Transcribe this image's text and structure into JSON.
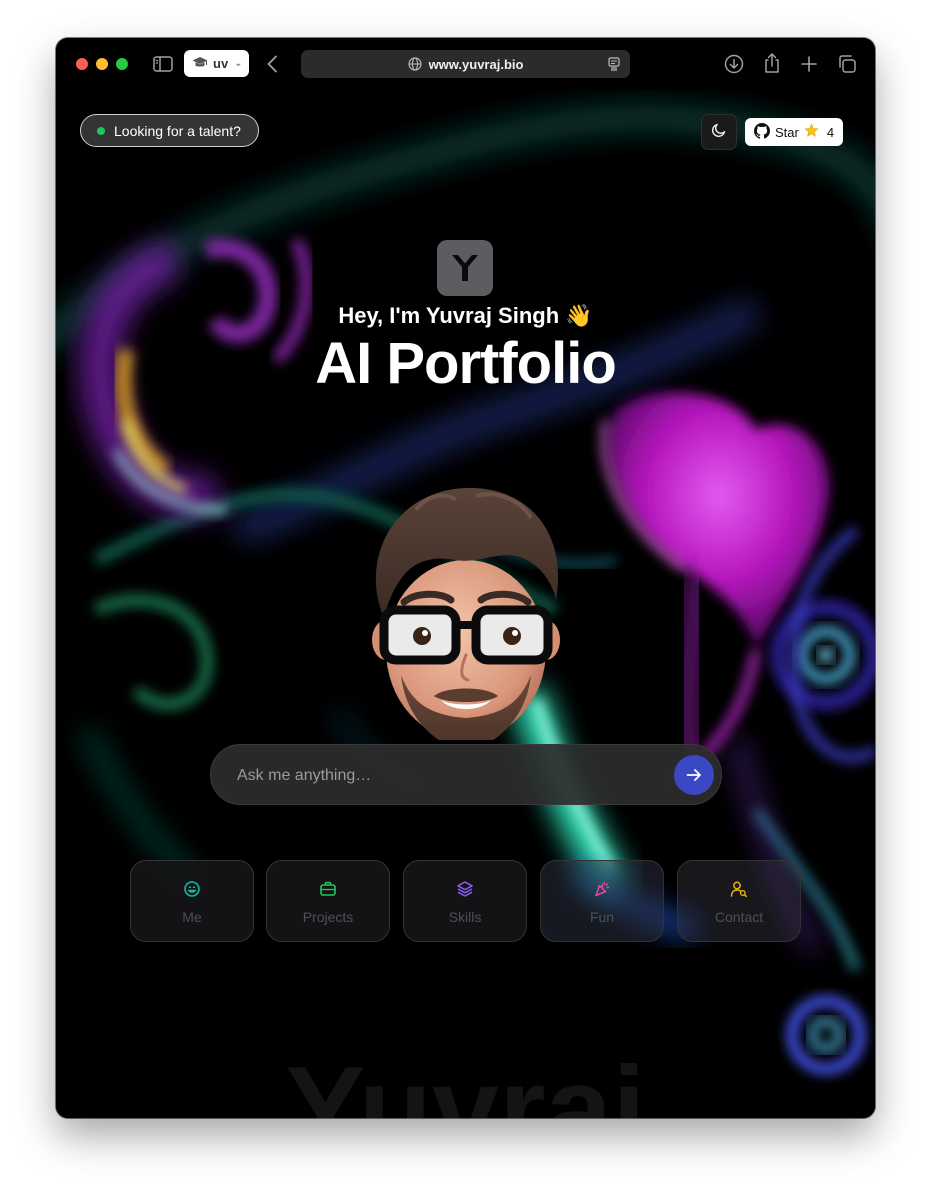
{
  "browser": {
    "tab_group_label": "uv",
    "url": "www.yuvraj.bio"
  },
  "header": {
    "talent_label": "Looking for a talent?",
    "github_star_label": "Star",
    "github_star_count": "4"
  },
  "hero": {
    "greeting": "Hey, I'm Yuvraj Singh 👋",
    "title": "AI Portfolio"
  },
  "chat": {
    "placeholder": "Ask me anything…"
  },
  "quick_actions": [
    {
      "label": "Me",
      "color": "#14b8a6"
    },
    {
      "label": "Projects",
      "color": "#22c55e"
    },
    {
      "label": "Skills",
      "color": "#8b5cf6"
    },
    {
      "label": "Fun",
      "color": "#ec4899"
    },
    {
      "label": "Contact",
      "color": "#eab308"
    }
  ],
  "watermark": "Yuvraj",
  "colors": {
    "status_dot": "#22c55e",
    "send_button": "#3b48c4"
  }
}
